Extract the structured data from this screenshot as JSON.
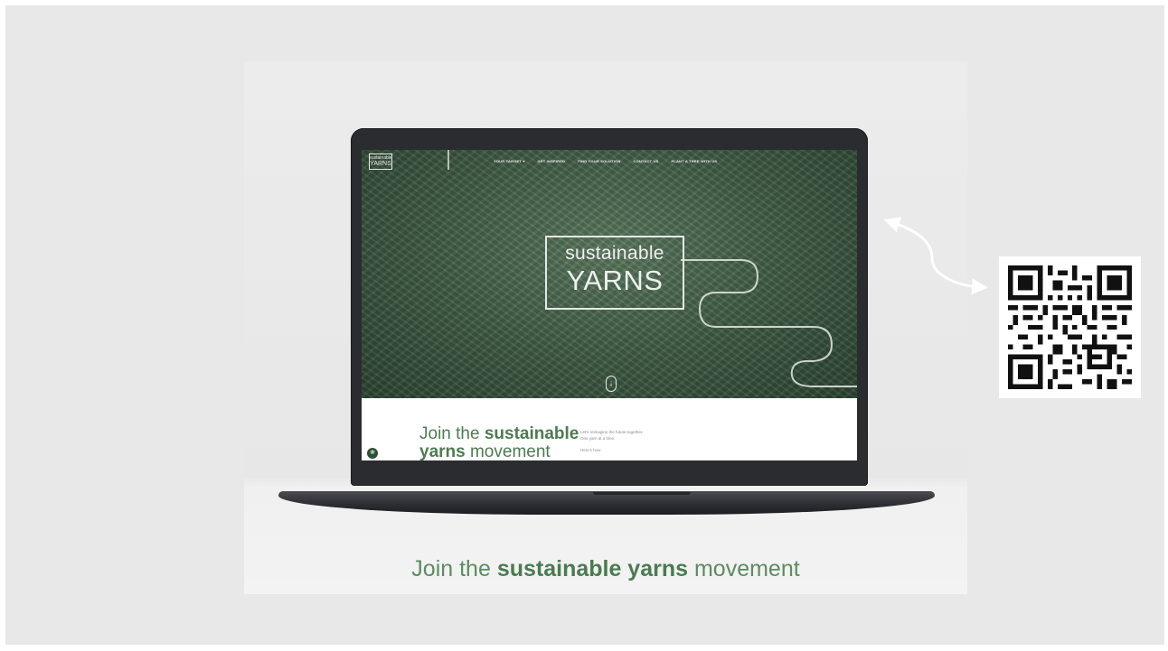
{
  "website": {
    "logo_small_top": "sustainable",
    "logo_small_bottom": "YARNS",
    "nav": [
      "YOUR TARGET ▾",
      "GET INSPIRED",
      "FIND YOUR SOLUTION",
      "CONTACT US",
      "PLANT A TREE WITH US"
    ],
    "hero_logo_line1": "sustainable",
    "hero_logo_line2": "YARNS",
    "scroll_icon": "↓",
    "join_part1": "Join the ",
    "join_bold": "sustainable",
    "join_part2": "yarns",
    "join_part3": " movement",
    "copy_line1": "Let's reimagine the future together.",
    "copy_line2": "One yarn at a time.",
    "copy_link": "Here's how",
    "chat_icon": "leaf-icon"
  },
  "caption": {
    "part1": "Join the ",
    "bold": "sustainable yarns",
    "part2": " movement"
  },
  "qr_icon": "qr-code",
  "colors": {
    "brand_green": "#4e7a53",
    "hero_green": "#3e5a44",
    "laptop": "#2a2c30",
    "slide_bg": "#e8e8e8"
  }
}
